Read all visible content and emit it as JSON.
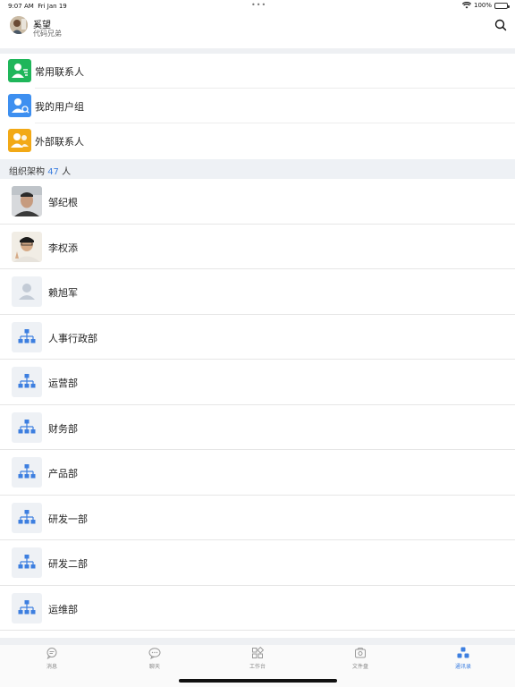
{
  "status_bar": {
    "time": "9:07 AM",
    "date": "Fri Jan 19",
    "battery_text": "100%",
    "battery_level": 1.0,
    "wifi_icon": "wifi-icon"
  },
  "header": {
    "user_name": "奚望",
    "user_subtitle": "代码兄弟",
    "search_icon": "search-icon"
  },
  "quick_entries": [
    {
      "label": "常用联系人",
      "icon": "frequent-contacts-icon",
      "color": "#1fb65a"
    },
    {
      "label": "我的用户组",
      "icon": "user-group-icon",
      "color": "#3d8ff0"
    },
    {
      "label": "外部联系人",
      "icon": "external-contacts-icon",
      "color": "#f2a916"
    }
  ],
  "org_section": {
    "title": "组织架构",
    "count": "47",
    "unit": "人"
  },
  "org_list": [
    {
      "label": "邹纪根",
      "type": "person-photo-1"
    },
    {
      "label": "李权添",
      "type": "person-photo-2"
    },
    {
      "label": "赖旭军",
      "type": "person-placeholder"
    },
    {
      "label": "人事行政部",
      "type": "department"
    },
    {
      "label": "运营部",
      "type": "department"
    },
    {
      "label": "财务部",
      "type": "department"
    },
    {
      "label": "产品部",
      "type": "department"
    },
    {
      "label": "研发一部",
      "type": "department"
    },
    {
      "label": "研发二部",
      "type": "department"
    },
    {
      "label": "运维部",
      "type": "department"
    }
  ],
  "tab_bar": {
    "tabs": [
      {
        "label": "消息",
        "icon": "message-icon",
        "active": false
      },
      {
        "label": "聊天",
        "icon": "chat-icon",
        "active": false
      },
      {
        "label": "工作台",
        "icon": "workbench-icon",
        "active": false
      },
      {
        "label": "文件盘",
        "icon": "file-drive-icon",
        "active": false
      },
      {
        "label": "通讯录",
        "icon": "contacts-icon",
        "active": true
      }
    ],
    "accent_color": "#3d7fe0"
  }
}
